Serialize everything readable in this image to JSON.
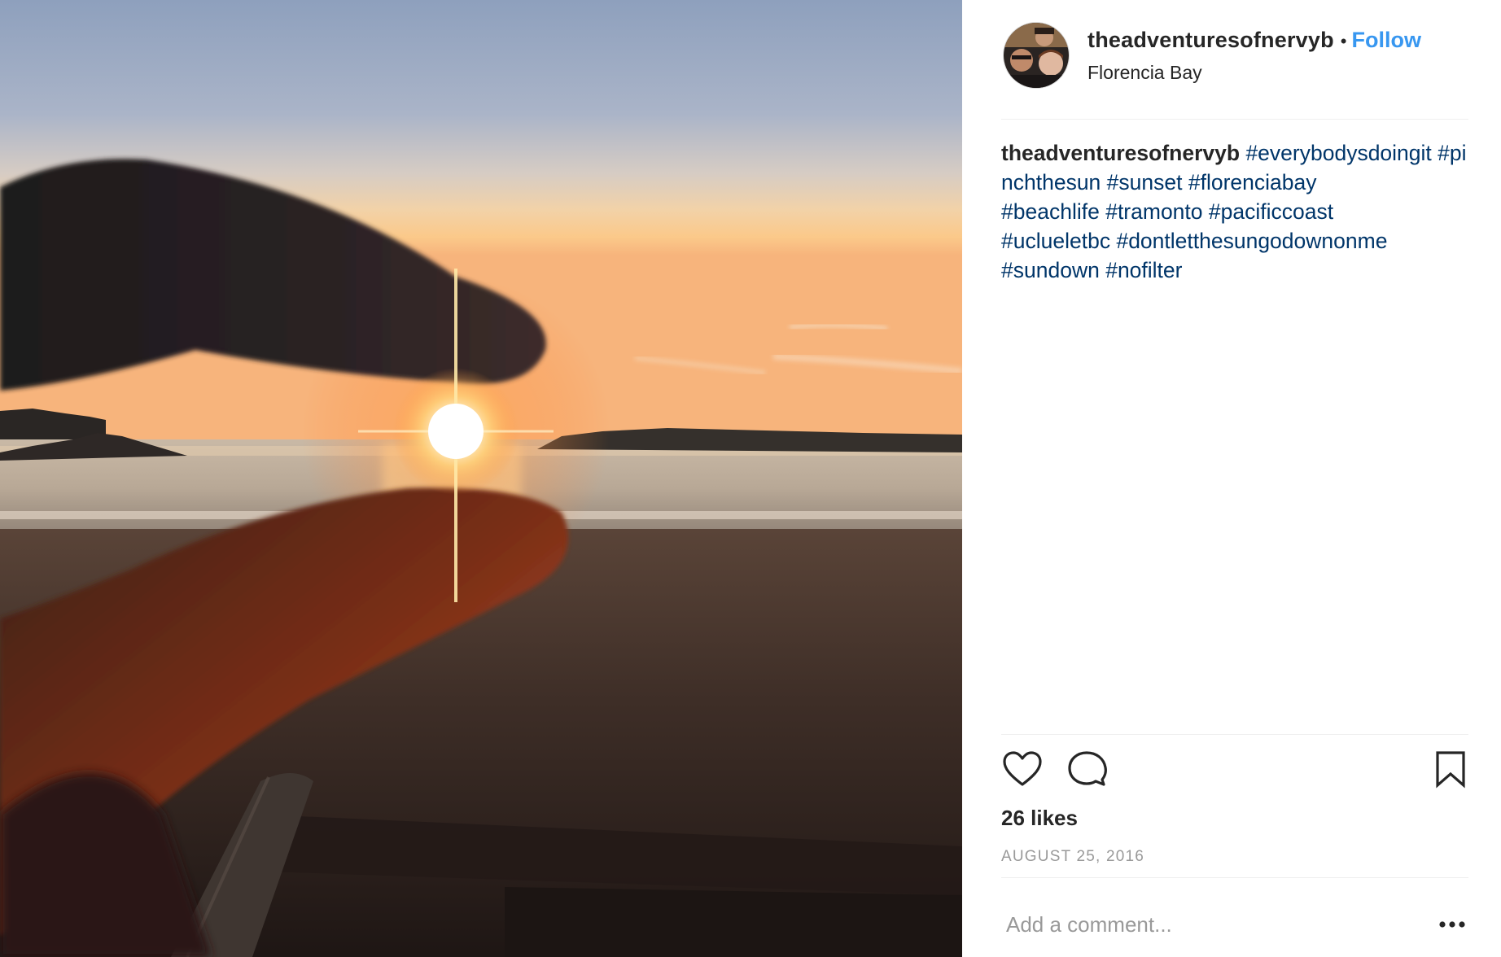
{
  "post": {
    "username": "theadventuresofnervyb",
    "separator": "•",
    "follow_label": "Follow",
    "location": "Florencia Bay",
    "caption": {
      "username": "theadventuresofnervyb",
      "hashtags": [
        "#everybodysdoingit",
        "#pinchthesun",
        "#sunset",
        "#florenciabay",
        "#beachlife",
        "#tramonto",
        "#pacificcoast",
        "#uclueletbc",
        "#dontletthesungodownonme",
        "#sundown",
        "#nofilter"
      ]
    },
    "likes": "26 likes",
    "date": "AUGUST 25, 2016",
    "comment": {
      "placeholder": "Add a comment...",
      "value": ""
    }
  },
  "icons": {
    "like": "heart-icon",
    "comment": "speech-bubble-icon",
    "save": "bookmark-icon",
    "more": "more-options-icon"
  },
  "colors": {
    "follow": "#3897f0",
    "hashtag": "#003569",
    "text": "#262626",
    "muted": "#999999",
    "divider": "#efefef"
  }
}
